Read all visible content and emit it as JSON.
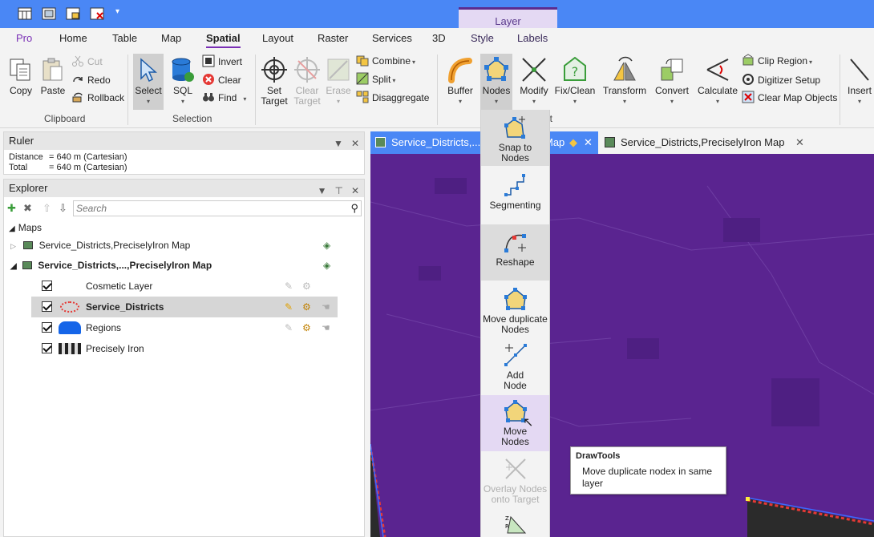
{
  "ribbon_tabs": [
    "Pro",
    "Home",
    "Table",
    "Map",
    "Spatial",
    "Layout",
    "Raster",
    "Services",
    "3D",
    "Style",
    "Labels"
  ],
  "context_group": "Layer",
  "active_tab": "Spatial",
  "clipboard": {
    "copy": "Copy",
    "paste": "Paste",
    "cut": "Cut",
    "redo": "Redo",
    "rollback": "Rollback",
    "group": "Clipboard"
  },
  "selection": {
    "select": "Select",
    "sql": "SQL",
    "invert": "Invert",
    "clear": "Clear",
    "find": "Find",
    "group": "Selection"
  },
  "edit": {
    "set_target": "Set Target",
    "clear_target": "Clear Target",
    "erase": "Erase",
    "combine": "Combine",
    "split": "Split",
    "disaggregate": "Disaggregate"
  },
  "tools": {
    "buffer": "Buffer",
    "nodes": "Nodes",
    "modify": "Modify",
    "fix_clean": "Fix/Clean",
    "transform": "Transform",
    "convert": "Convert",
    "calculate": "Calculate",
    "clip_region": "Clip Region",
    "digitizer_setup": "Digitizer Setup",
    "clear_map_objects": "Clear Map Objects",
    "insert": "Insert",
    "group_partial": "it"
  },
  "ruler": {
    "title": "Ruler",
    "distance_label": "Distance",
    "distance_value": "= 640 m (Cartesian)",
    "total_label": "Total",
    "total_value": "= 640 m (Cartesian)"
  },
  "explorer": {
    "title": "Explorer",
    "search_placeholder": "Search",
    "maps_label": "Maps",
    "map1": "Service_Districts,PreciselyIron Map",
    "map2": "Service_Districts,...,PreciselyIron Map",
    "layers": [
      "Cosmetic Layer",
      "Service_Districts",
      "Regions",
      "Precisely Iron"
    ]
  },
  "doc_tabs": {
    "tab1": "Service_Districts,...,",
    "tab1_suffix": "Map",
    "tab2": "Service_Districts,PreciselyIron Map"
  },
  "nodes_menu": [
    "Snap to Nodes",
    "Segmenting",
    "Reshape",
    "Move duplicate Nodes",
    "Add Node",
    "Move Nodes",
    "Overlay Nodes onto Target"
  ],
  "tooltip": {
    "title": "DrawTools",
    "body": "Move duplicate nodex in same layer"
  },
  "colors": {
    "title_bar": "#4a87f5",
    "accent": "#7a2fb5",
    "map_bg": "#5a2490",
    "context_tab": "#e4d9f3"
  }
}
